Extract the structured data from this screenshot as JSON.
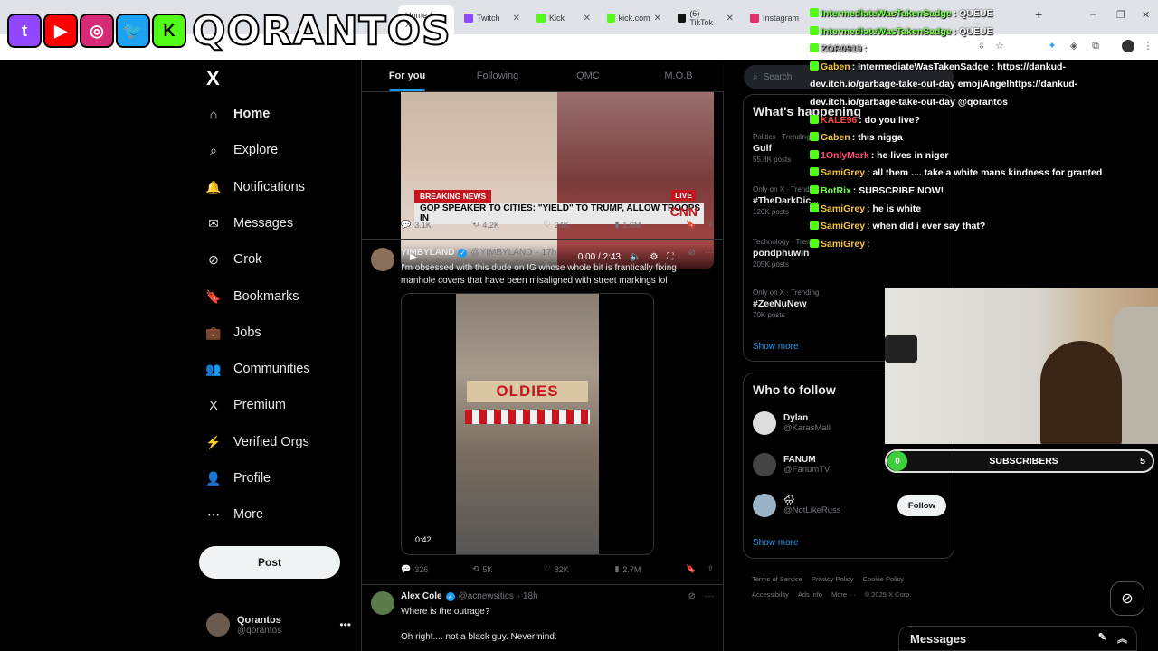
{
  "browser": {
    "tabs": [
      {
        "label": "Home / X",
        "color": "#000000",
        "active": true
      },
      {
        "label": "Twitch",
        "color": "#9146ff"
      },
      {
        "label": "Kick",
        "color": "#53fc18"
      },
      {
        "label": "kick.com",
        "color": "#53fc18"
      },
      {
        "label": "(6) TikTok",
        "color": "#111111"
      },
      {
        "label": "Instagram",
        "color": "#e1306c"
      }
    ],
    "new_tab": "+",
    "window_controls": [
      "–",
      "❐",
      "✕"
    ]
  },
  "overlay": {
    "banner_text": "QORANTOS",
    "banner_icons": [
      {
        "name": "twitch",
        "glyph": "t",
        "color": "#9146ff"
      },
      {
        "name": "youtube",
        "glyph": "▶",
        "color": "#ff0000"
      },
      {
        "name": "instagram",
        "glyph": "◎",
        "color": "#d62976"
      },
      {
        "name": "twitter",
        "glyph": "🐦",
        "color": "#1da1f2"
      },
      {
        "name": "kick",
        "glyph": "K",
        "color": "#53fc18"
      }
    ],
    "subscribers": {
      "label": "SUBSCRIBERS",
      "current": "0",
      "goal": "5"
    }
  },
  "chat": [
    {
      "user": "IntermediateWasTakenSadge",
      "user_color": "#7cff4f",
      "msg": ": QUEUE"
    },
    {
      "user": "IntermediateWasTakenSadge",
      "user_color": "#7cff4f",
      "msg": ": QUEUE"
    },
    {
      "user": "ZOR0919",
      "user_color": "#b0b0b0",
      "msg": ":"
    },
    {
      "user": "Gaben",
      "user_color": "#f5c542",
      "msg": ": IntermediateWasTakenSadge : https://dankud-"
    },
    {
      "user": "",
      "user_color": "#ffffff",
      "msg": "dev.itch.io/garbage-take-out-day emojiAngelhttps://dankud-"
    },
    {
      "user": "",
      "user_color": "#ffffff",
      "msg": "dev.itch.io/garbage-take-out-day @qorantos"
    },
    {
      "user": "KALE96",
      "user_color": "#ff4444",
      "msg": ":       do you live?"
    },
    {
      "user": "Gaben",
      "user_color": "#f5c542",
      "msg": ": this nigga"
    },
    {
      "user": "1OnlyMark",
      "user_color": "#ff4f7a",
      "msg": ": he lives in niger"
    },
    {
      "user": "SamiGrey",
      "user_color": "#f5c542",
      "msg": ": all them .... take a white mans kindness for granted"
    },
    {
      "user": "BotRix",
      "user_color": "#7cff4f",
      "msg": ": SUBSCRIBE NOW!"
    },
    {
      "user": "SamiGrey",
      "user_color": "#f5c542",
      "msg": ": he is white"
    },
    {
      "user": "SamiGrey",
      "user_color": "#f5c542",
      "msg": ": when did i ever say that?"
    },
    {
      "user": "SamiGrey",
      "user_color": "#f5c542",
      "msg": ":"
    }
  ],
  "nav": {
    "logo": "X",
    "items": [
      {
        "label": "Home",
        "icon": "⌂"
      },
      {
        "label": "Explore",
        "icon": "⌕"
      },
      {
        "label": "Notifications",
        "icon": "🔔"
      },
      {
        "label": "Messages",
        "icon": "✉"
      },
      {
        "label": "Grok",
        "icon": "⊘"
      },
      {
        "label": "Bookmarks",
        "icon": "🔖"
      },
      {
        "label": "Jobs",
        "icon": "💼"
      },
      {
        "label": "Communities",
        "icon": "👥"
      },
      {
        "label": "Premium",
        "icon": "X"
      },
      {
        "label": "Verified Orgs",
        "icon": "⚡"
      },
      {
        "label": "Profile",
        "icon": "👤"
      },
      {
        "label": "More",
        "icon": "⋯"
      }
    ],
    "post_label": "Post",
    "account": {
      "name": "Qorantos",
      "handle": "@qorantos"
    }
  },
  "timeline": {
    "tabs": [
      "For you",
      "Following",
      "QMC",
      "M.O.B"
    ],
    "video1": {
      "breaking": "BREAKING NEWS",
      "live": "LIVE",
      "headline": "GOP SPEAKER TO CITIES: \"YIELD\" TO TRUMP, ALLOW TROOPS IN",
      "network": "CNN",
      "time": "0:00 / 2:43"
    },
    "post1_actions": {
      "replies": "3.1K",
      "reposts": "4.2K",
      "likes": "24K",
      "views": "1.6M"
    },
    "post2": {
      "name": "YIMBYLAND",
      "handle": "@YIMBYLAND",
      "time": "· 17h",
      "text": "I'm obsessed with this dude on IG whose whole bit is frantically fixing manhole covers that have been misaligned with street markings lol",
      "sign": "OLDIES",
      "duration": "0:42",
      "actions": {
        "replies": "326",
        "reposts": "5K",
        "likes": "82K",
        "views": "2.7M"
      }
    },
    "post3": {
      "name": "Alex Cole",
      "handle": "@acnewsitics",
      "time": "· 18h",
      "line1": "Where is the outrage?",
      "line2": "Oh right.... not a black guy. Nevermind."
    }
  },
  "sidebar": {
    "search_placeholder": "Search",
    "happening_title": "What's happening",
    "trends": [
      {
        "context": "Politics · Trending",
        "title": "Gulf",
        "count": "55.8K posts"
      },
      {
        "context": "Only on X · Trending",
        "title": "#TheDarkDic...",
        "count": "120K posts"
      },
      {
        "context": "Technology · Trending",
        "title": "pondphuwin",
        "count": "205K posts"
      },
      {
        "context": "Only on X · Trending",
        "title": "#ZeeNuNew",
        "count": "70K posts"
      }
    ],
    "show_more": "Show more",
    "follow_title": "Who to follow",
    "follow": [
      {
        "name": "Dylan",
        "handle": "@KarasMall",
        "button": "Follow"
      },
      {
        "name": "FANUM",
        "handle": "@FanumTV",
        "button": "Follow"
      },
      {
        "name": "🌧",
        "handle": "@NotLikeRuss",
        "button": "Follow"
      }
    ],
    "show_more2": "Show more",
    "footer": [
      "Terms of Service",
      "Privacy Policy",
      "Cookie Policy",
      "Accessibility",
      "Ads info",
      "More ···",
      "© 2025 X Corp."
    ]
  },
  "messages_bar": {
    "title": "Messages"
  }
}
